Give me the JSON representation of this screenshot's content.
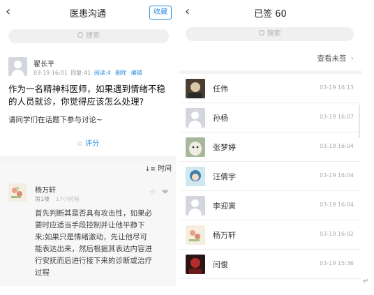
{
  "left": {
    "back_icon": "chevron-left-icon",
    "title": "医患沟通",
    "collect": "收藏",
    "search_placeholder": "搜索",
    "post": {
      "author": "翟长平",
      "date": "03-19 16:01",
      "reply": "回复:41",
      "read": "阅读:4",
      "delete": "删除",
      "edit": "编辑",
      "question_line1": "作为一名精神科医师，如果遇到情绪不稳",
      "question_line2": "的人员就诊，你觉得应该怎么处理?",
      "prompt": "请同学们在话题下参与讨论~",
      "rate": "评分"
    },
    "sort_label": "时间",
    "reply": {
      "author": "杨万轩",
      "floor": "第1楼",
      "time_ago": "17小时前",
      "lines": [
        "首先判断其是否具有攻击性，如果必",
        "要时应适当手段控制并让他平静下",
        "来;如果只是情绪激动，先让他尽可",
        "能表达出来，然后根据其表达内容进",
        "行安抚而后进行接下来的诊断或治疗",
        "过程"
      ]
    }
  },
  "right": {
    "back_icon": "chevron-left-icon",
    "title": "已签 60",
    "search_placeholder": "搜索",
    "view_unsigned": "查看未签",
    "people": [
      {
        "name": "任伟",
        "time": "03-19 16:13",
        "avatar": "photo-dark"
      },
      {
        "name": "孙杨",
        "time": "03-19 16:07",
        "avatar": "default-gray"
      },
      {
        "name": "张梦婷",
        "time": "03-19 16:04",
        "avatar": "photo-alpaca"
      },
      {
        "name": "汪倩宇",
        "time": "03-19 16:04",
        "avatar": "photo-anime"
      },
      {
        "name": "李迎寅",
        "time": "03-19 16:04",
        "avatar": "default-gray"
      },
      {
        "name": "杨万轩",
        "time": "03-19 16:02",
        "avatar": "photo-floral"
      },
      {
        "name": "闫俊",
        "time": "03-19 15:36",
        "avatar": "photo-red"
      }
    ]
  },
  "colors": {
    "accent": "#2d8fe0",
    "divider": "#f3f3f3"
  }
}
